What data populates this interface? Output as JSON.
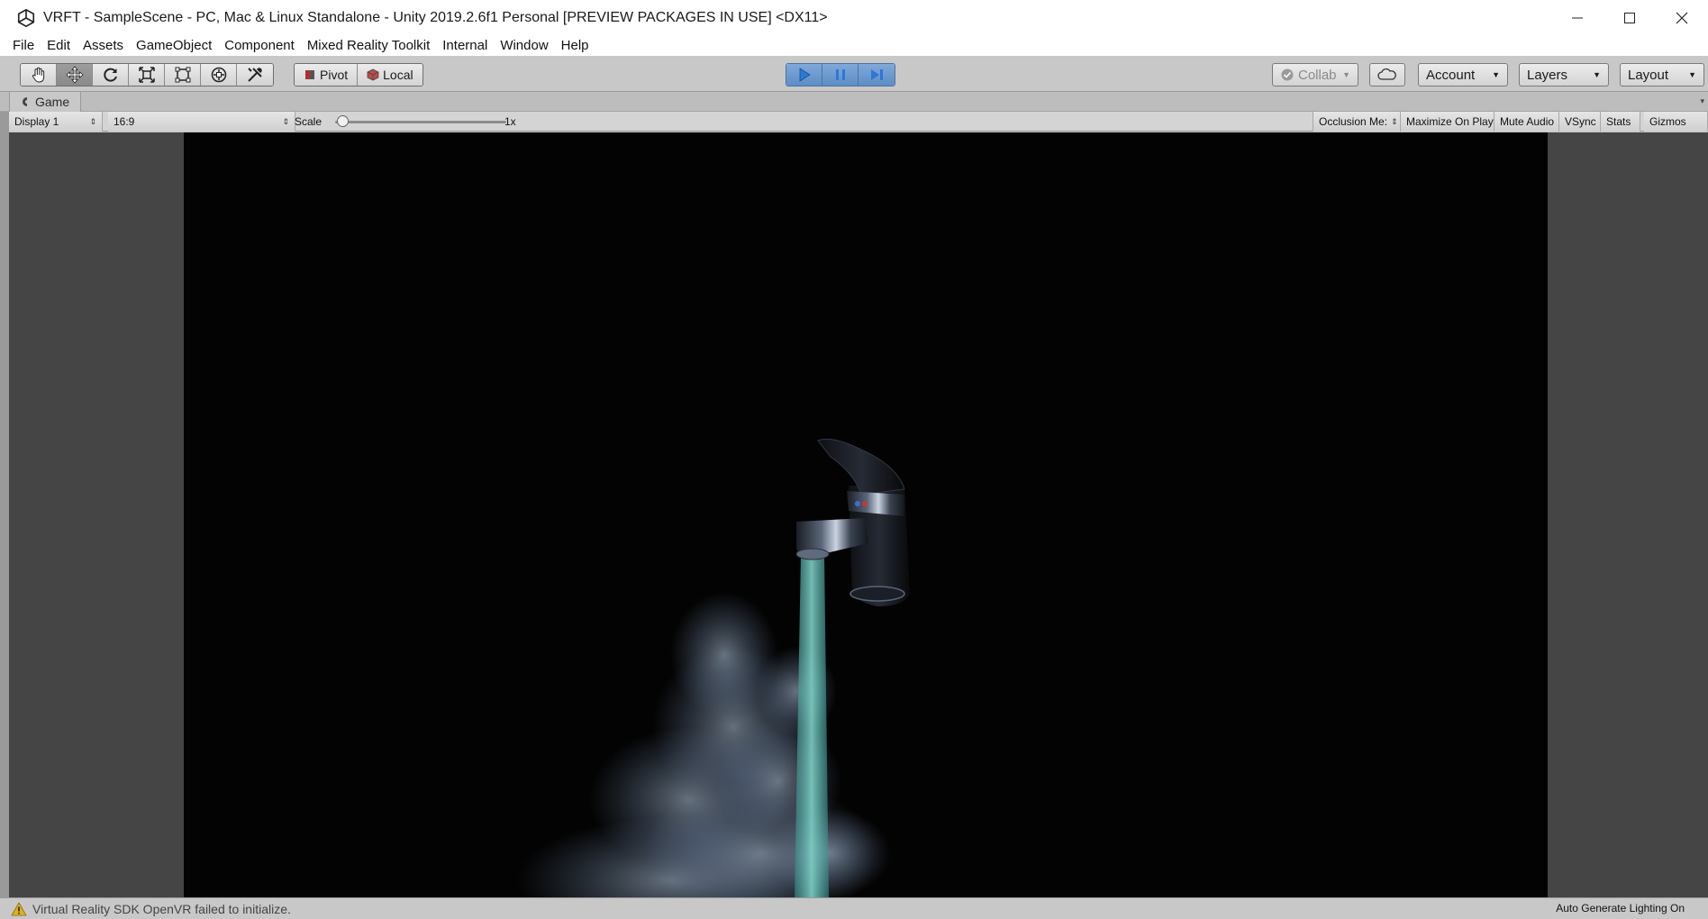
{
  "window": {
    "title": "VRFT - SampleScene - PC, Mac & Linux Standalone - Unity 2019.2.6f1 Personal [PREVIEW PACKAGES IN USE] <DX11>"
  },
  "menu": [
    "File",
    "Edit",
    "Assets",
    "GameObject",
    "Component",
    "Mixed Reality Toolkit",
    "Internal",
    "Window",
    "Help"
  ],
  "toolbar": {
    "tools": [
      "hand-tool-icon",
      "move-tool-icon",
      "rotate-tool-icon",
      "scale-tool-icon",
      "rect-tool-icon",
      "transform-tool-icon",
      "custom-tool-icon"
    ],
    "pivot_label": "Pivot",
    "local_label": "Local",
    "collab_label": "Collab",
    "account_label": "Account",
    "layers_label": "Layers",
    "layout_label": "Layout",
    "accent_color": "#2f76d6"
  },
  "game_tab": {
    "label": "Game"
  },
  "game_toolbar": {
    "display": "Display 1",
    "aspect": "16:9",
    "scale_label": "Scale",
    "scale_value": "1x",
    "occlusion": "Occlusion Me:",
    "maximize": "Maximize On Play",
    "mute": "Mute Audio",
    "vsync": "VSync",
    "stats": "Stats",
    "gizmos": "Gizmos"
  },
  "status": {
    "message": "Virtual Reality SDK OpenVR failed to initialize.",
    "right": "Auto Generate Lighting On",
    "warning_color": "#e0b020"
  }
}
